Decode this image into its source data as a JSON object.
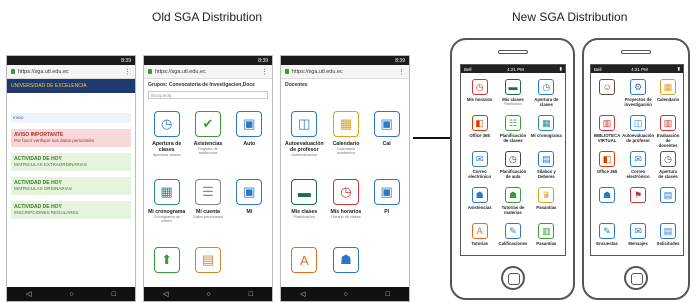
{
  "headings": {
    "old": "Old SGA Distribution",
    "new": "New SGA Distribution"
  },
  "android_status": {
    "time": "8:39"
  },
  "url": "https://sga.utl.edu.ec",
  "phone1": {
    "banner": "UNIVERSIDAD DE EXCELENCIA",
    "crumb": "Inicio",
    "notices": [
      {
        "title": "AVISO IMPORTANTE",
        "text": "Por favor verifique sus datos personales",
        "tone": "pink"
      },
      {
        "title": "ACTIVIDAD DE HOY",
        "text": "MATRICULAS EXTRAORDINARIAS",
        "tone": "green"
      },
      {
        "title": "ACTIVIDAD DE HOY",
        "text": "MATRICULAS ORDINARIAS",
        "tone": "green"
      },
      {
        "title": "ACTIVIDAD DE HOY",
        "text": "INSCRIPCIONES REGULARES",
        "tone": "green"
      }
    ]
  },
  "phone2": {
    "group": "Grupos: Convocatoria de Investigacion,Doce",
    "search_placeholder": "Busqueda",
    "tiles": [
      {
        "label": "Apertura de clases",
        "sub": "Aperturar clases",
        "icon": "clock-icon",
        "glyph": "◷",
        "color": "#2b78c5"
      },
      {
        "label": "Asistencias",
        "sub": "Registro de asistencias",
        "icon": "clipboard-icon",
        "glyph": "✔",
        "color": "#3a9a3a"
      },
      {
        "label": "Auto",
        "sub": "",
        "icon": "tile-icon",
        "glyph": "▣",
        "color": "#2b78c5"
      },
      {
        "label": "Mi cronograma",
        "sub": "Cronograma de clases",
        "icon": "calendar-icon",
        "glyph": "▦",
        "color": "#2a8a8a"
      },
      {
        "label": "Mi cuenta",
        "sub": "Datos personales",
        "icon": "document-icon",
        "glyph": "☰",
        "color": "#888"
      },
      {
        "label": "Mi",
        "sub": "",
        "icon": "tile-icon",
        "glyph": "▣",
        "color": "#2b78c5"
      },
      {
        "label": "",
        "sub": "",
        "icon": "upload-icon",
        "glyph": "⬆",
        "color": "#3a9a3a"
      },
      {
        "label": "",
        "sub": "",
        "icon": "page-icon",
        "glyph": "▤",
        "color": "#c98a2a"
      }
    ]
  },
  "phone3": {
    "title": "Docentes",
    "tiles": [
      {
        "label": "Autoevaluación de profesor",
        "sub": "Autoevaluación",
        "icon": "tablet-icon",
        "glyph": "◫",
        "color": "#2b78c5"
      },
      {
        "label": "Calendario",
        "sub": "Calendario académico",
        "icon": "calendar-icon",
        "glyph": "▦",
        "color": "#e0a020"
      },
      {
        "label": "Cal",
        "sub": "",
        "icon": "tile-icon",
        "glyph": "▣",
        "color": "#2b78c5"
      },
      {
        "label": "Mis clases",
        "sub": "Planificación",
        "icon": "board-icon",
        "glyph": "▬",
        "color": "#1e6b4a"
      },
      {
        "label": "Mis horarios",
        "sub": "Horario de clases",
        "icon": "clock-icon",
        "glyph": "◷",
        "color": "#c33"
      },
      {
        "label": "Pl",
        "sub": "",
        "icon": "tile-icon",
        "glyph": "▣",
        "color": "#2b78c5"
      },
      {
        "label": "",
        "sub": "",
        "icon": "letter-a-icon",
        "glyph": "A",
        "color": "#e07020"
      },
      {
        "label": "",
        "sub": "",
        "icon": "people-icon",
        "glyph": "☗",
        "color": "#2b78c5"
      }
    ]
  },
  "ios_status": {
    "carrier": "Bell",
    "time": "4:21 PM"
  },
  "iphone1": {
    "tiles": [
      {
        "label": "Mis horarios",
        "sub": "",
        "icon": "clock-icon",
        "glyph": "◷",
        "color": "#c33"
      },
      {
        "label": "Mis clases",
        "sub": "Planificación",
        "icon": "board-icon",
        "glyph": "▬",
        "color": "#1e6b4a"
      },
      {
        "label": "Apertura de clases",
        "sub": "",
        "icon": "clock-icon",
        "glyph": "◷",
        "color": "#2b78c5"
      },
      {
        "label": "Office 365",
        "sub": "",
        "icon": "office-icon",
        "glyph": "◧",
        "color": "#d83b01"
      },
      {
        "label": "Planificación de clases",
        "sub": "",
        "icon": "clipboard-icon",
        "glyph": "☷",
        "color": "#3a9a3a"
      },
      {
        "label": "Mi cronograma",
        "sub": "",
        "icon": "calendar-icon",
        "glyph": "▦",
        "color": "#2a8a8a"
      },
      {
        "label": "Correo electrónico",
        "sub": "",
        "icon": "mail-icon",
        "glyph": "✉",
        "color": "#2b78c5"
      },
      {
        "label": "Planificación de aula",
        "sub": "",
        "icon": "clock-icon",
        "glyph": "◷",
        "color": "#444"
      },
      {
        "label": "Sílabos y Deberes",
        "sub": "",
        "icon": "book-icon",
        "glyph": "▤",
        "color": "#2b78c5"
      },
      {
        "label": "Asistencias",
        "sub": "",
        "icon": "person-icon",
        "glyph": "☗",
        "color": "#2b78c5"
      },
      {
        "label": "Tutorías de materias",
        "sub": "",
        "icon": "group-icon",
        "glyph": "☗",
        "color": "#3a9a3a"
      },
      {
        "label": "Pasantías",
        "sub": "",
        "icon": "trophy-icon",
        "glyph": "♛",
        "color": "#e0a020"
      },
      {
        "label": "Tutorías",
        "sub": "",
        "icon": "letter-a-icon",
        "glyph": "A",
        "color": "#e07020"
      },
      {
        "label": "Calificaciones",
        "sub": "",
        "icon": "pencil-icon",
        "glyph": "✎",
        "color": "#2b78c5"
      },
      {
        "label": "Pasantías",
        "sub": "",
        "icon": "chart-icon",
        "glyph": "▥",
        "color": "#3a9a3a"
      }
    ]
  },
  "iphone2": {
    "tiles": [
      {
        "label": "",
        "sub": "",
        "icon": "avatar-icon",
        "glyph": "☺",
        "color": "#6b4b3a"
      },
      {
        "label": "Proyectos de investigación",
        "sub": "",
        "icon": "network-icon",
        "glyph": "⚙",
        "color": "#2b78c5"
      },
      {
        "label": "Calendario",
        "sub": "",
        "icon": "calendar-icon",
        "glyph": "▦",
        "color": "#e0a020"
      },
      {
        "label": "BIBLIOTECA VIRTUAL",
        "sub": "",
        "icon": "library-icon",
        "glyph": "▥",
        "color": "#c33"
      },
      {
        "label": "Autoevaluación de profesor",
        "sub": "",
        "icon": "tablet-icon",
        "glyph": "◫",
        "color": "#2b78c5"
      },
      {
        "label": "Evaluación de docentes",
        "sub": "",
        "icon": "chart-icon",
        "glyph": "▥",
        "color": "#c33"
      },
      {
        "label": "Office 365",
        "sub": "",
        "icon": "office-icon",
        "glyph": "◧",
        "color": "#d83b01"
      },
      {
        "label": "Correo electrónico",
        "sub": "",
        "icon": "mail-icon",
        "glyph": "✉",
        "color": "#2b78c5"
      },
      {
        "label": "Apertura de clases",
        "sub": "",
        "icon": "clock-icon",
        "glyph": "◷",
        "color": "#555"
      },
      {
        "label": "",
        "sub": "",
        "icon": "people-icon",
        "glyph": "☗",
        "color": "#2b78c5"
      },
      {
        "label": "",
        "sub": "",
        "icon": "flag-icon",
        "glyph": "⚑",
        "color": "#c33"
      },
      {
        "label": "",
        "sub": "",
        "icon": "document-icon",
        "glyph": "▤",
        "color": "#2b78c5"
      },
      {
        "label": "Encuestas",
        "sub": "",
        "icon": "survey-icon",
        "glyph": "✎",
        "color": "#2b78c5"
      },
      {
        "label": "Mensajes",
        "sub": "",
        "icon": "message-icon",
        "glyph": "✉",
        "color": "#2b78c5"
      },
      {
        "label": "Solicitudes",
        "sub": "",
        "icon": "request-icon",
        "glyph": "▤",
        "color": "#2b78c5"
      }
    ]
  },
  "colors": {
    "android_nav": "#111111",
    "sga_banner": "#1f3a6e",
    "pink_notice": "#f7d7d7",
    "green_notice": "#e6f4dd"
  }
}
